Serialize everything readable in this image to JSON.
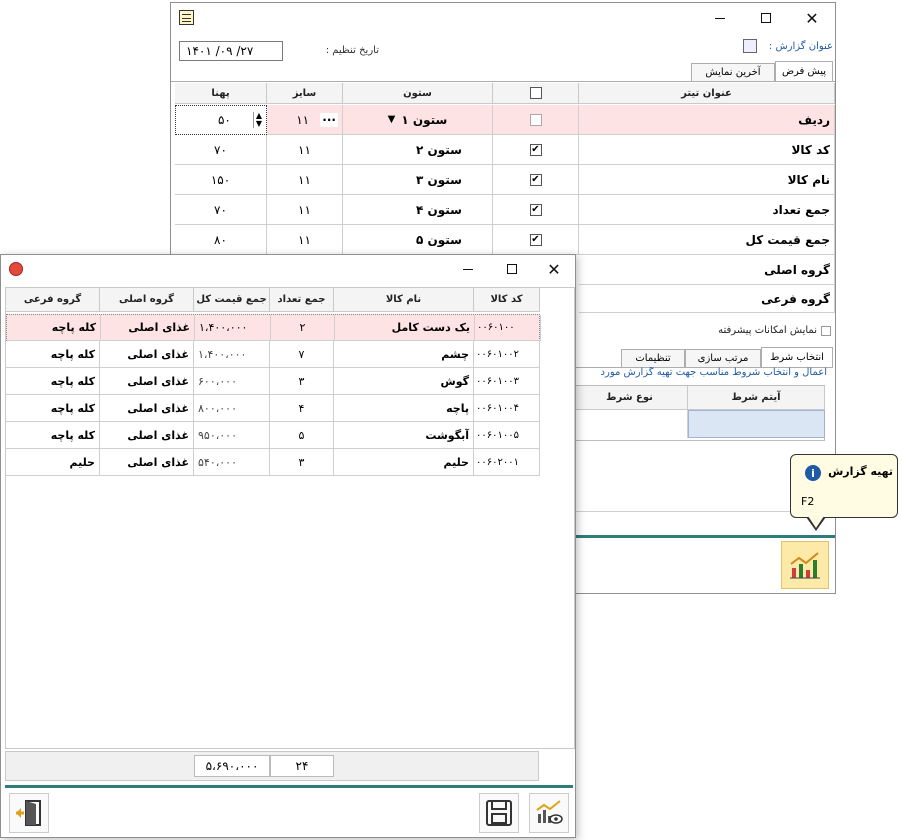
{
  "back_window": {
    "report_title_label": "عنوان گزارش :",
    "date_label": "تاریخ تنظیم :",
    "date_value": "۱۴۰۱ /۰۹ /۲۷",
    "tabs": [
      "پیش فرض",
      "آخرین نمایش"
    ],
    "grid_headers": {
      "title": "عنوان تیتر",
      "column": "ستون",
      "size": "سایز",
      "width": "پهنا"
    },
    "rows": [
      {
        "title": "ردیف",
        "column": "ستون ۱",
        "checked": false,
        "size": "۱۱",
        "width": "۵۰"
      },
      {
        "title": "کد کالا",
        "column": "ستون ۲",
        "checked": true,
        "size": "۱۱",
        "width": "۷۰"
      },
      {
        "title": "نام کالا",
        "column": "ستون ۳",
        "checked": true,
        "size": "۱۱",
        "width": "۱۵۰"
      },
      {
        "title": "جمع تعداد",
        "column": "ستون ۴",
        "checked": true,
        "size": "۱۱",
        "width": "۷۰"
      },
      {
        "title": "جمع قیمت کل",
        "column": "ستون ۵",
        "checked": true,
        "size": "۱۱",
        "width": "۸۰"
      },
      {
        "title": "گروه اصلی"
      },
      {
        "title": "گروه فرعی"
      }
    ],
    "advanced_label": "نمایش امکانات پیشرفته",
    "filter_tabs": [
      "انتخاب شرط",
      "مرتب سازی",
      "تنظیمات"
    ],
    "hint_text": "اعمال و انتخاب شروط مناسب جهت تهیه گزارش  مورد",
    "filter_headers": {
      "item": "آیتم شرط",
      "type": "نوع شرط"
    },
    "tooltip": {
      "title": "تهیه گزارش",
      "shortcut": "F2"
    }
  },
  "front_window": {
    "headers": {
      "code": "کد کالا",
      "name": "نام کالا",
      "qty": "جمع تعداد",
      "total": "جمع قیمت کل",
      "main": "گروه اصلی",
      "sub": "گروه فرعی"
    },
    "rows": [
      {
        "code": "۰۰۶۰۱۰۰",
        "name": "یک دست کامل",
        "qty": "۲",
        "total": "۱،۴۰۰،۰۰۰",
        "main": "غذای اصلی",
        "sub": "کله پاچه"
      },
      {
        "code": "۰۰۶۰۱۰۰۲",
        "name": "چشم",
        "qty": "۷",
        "total": "۱،۴۰۰،۰۰۰",
        "main": "غذای اصلی",
        "sub": "کله پاچه"
      },
      {
        "code": "۰۰۶۰۱۰۰۳",
        "name": "گوش",
        "qty": "۳",
        "total": "۶۰۰،۰۰۰",
        "main": "غذای اصلی",
        "sub": "کله پاچه"
      },
      {
        "code": "۰۰۶۰۱۰۰۴",
        "name": "پاچه",
        "qty": "۴",
        "total": "۸۰۰،۰۰۰",
        "main": "غذای اصلی",
        "sub": "کله پاچه"
      },
      {
        "code": "۰۰۶۰۱۰۰۵",
        "name": "آبگوشت",
        "qty": "۵",
        "total": "۹۵۰،۰۰۰",
        "main": "غذای اصلی",
        "sub": "کله پاچه"
      },
      {
        "code": "۰۰۶۰۲۰۰۱",
        "name": "حلیم",
        "qty": "۳",
        "total": "۵۴۰،۰۰۰",
        "main": "غذای اصلی",
        "sub": "حلیم"
      }
    ],
    "footer": {
      "qty_total": "۲۴",
      "price_total": "۵،۶۹۰،۰۰۰"
    }
  },
  "colors": {
    "selected_row": "#fde3e3",
    "divider": "#2e7d7a",
    "accent": "#1f5aa6"
  }
}
